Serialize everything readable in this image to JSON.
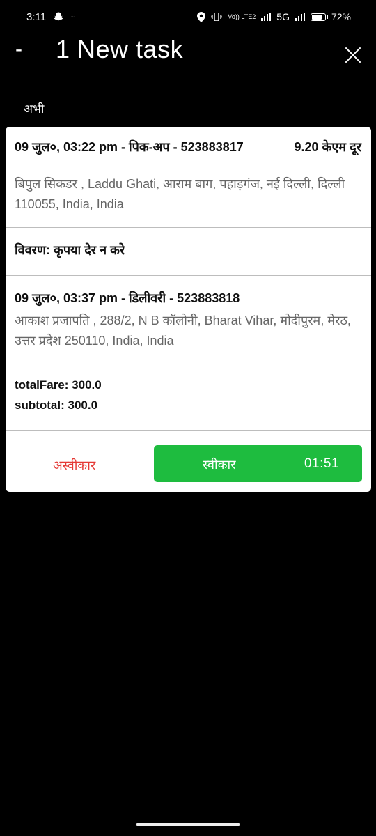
{
  "status_bar": {
    "time": "3:11",
    "notif_text": "~",
    "network_label": "Vo)) LTE2",
    "network_5g": "5G",
    "battery": "72%"
  },
  "header": {
    "back_glyph": "-",
    "title": "1 New task"
  },
  "section_label": "अभी",
  "task": {
    "pickup_heading": "09 जुल०, 03:22 pm - पिक-अप - 523883817",
    "distance": "9.20 केएम दूर",
    "pickup_address": "बिपुल सिकडर , Laddu Ghati, आराम बाग, पहाड़गंज, नई दिल्ली, दिल्ली 110055, India, India",
    "description": "विवरण: कृपया देर न करे",
    "drop_heading": "09 जुल०, 03:37 pm - डिलीवरी - 523883818",
    "drop_address": "आकाश प्रजापति , 288/2, N B कॉलोनी, Bharat Vihar, मोदीपुरम, मेरठ, उत्तर प्रदेश 250110, India, India",
    "total_fare": "totalFare: 300.0",
    "subtotal": "subtotal: 300.0"
  },
  "actions": {
    "reject_label": "अस्वीकार",
    "accept_label": "स्वीकार",
    "timer": "01:51"
  },
  "colors": {
    "accept": "#1ebc3f",
    "reject": "#e53935",
    "background": "#000000"
  },
  "icons": [
    "snapchat-icon",
    "location-icon",
    "vibrate-icon",
    "signal-icon",
    "battery-icon",
    "close-icon"
  ]
}
